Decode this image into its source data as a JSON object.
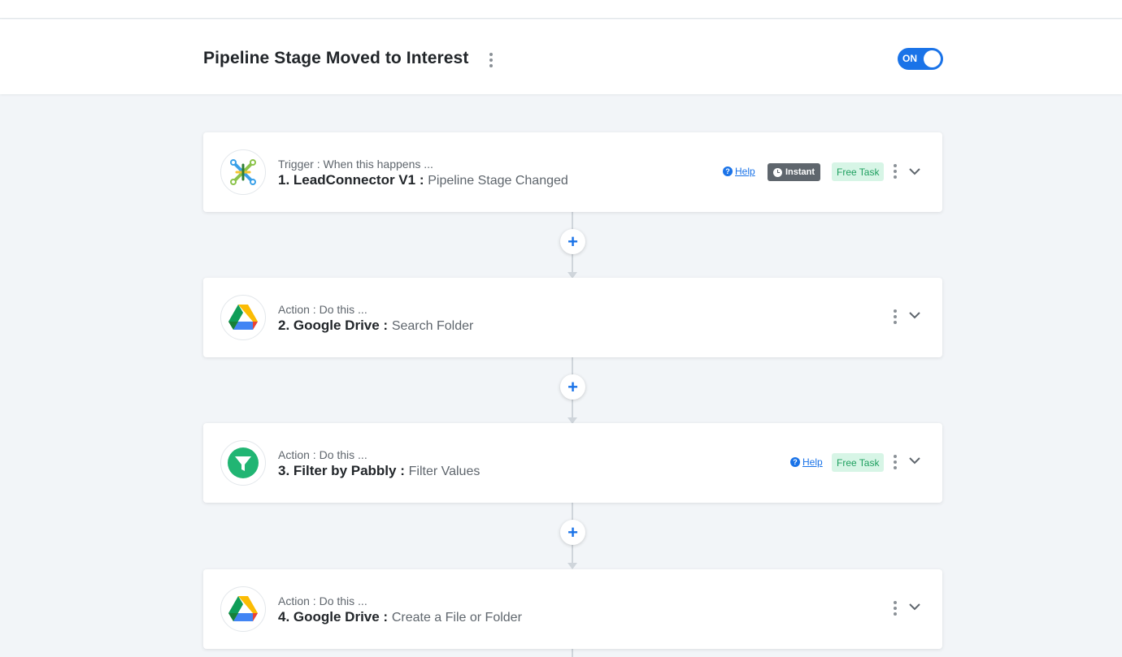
{
  "header": {
    "title": "Pipeline Stage Moved to Interest",
    "toggle_label": "ON"
  },
  "steps": [
    {
      "sub": "Trigger : When this happens ...",
      "app": "1. LeadConnector V1 :",
      "event": "Pipeline Stage Changed",
      "help": "Help",
      "instant": "Instant",
      "free_task": "Free Task",
      "icon": "leadconnector-icon"
    },
    {
      "sub": "Action : Do this ...",
      "app": "2. Google Drive :",
      "event": "Search Folder",
      "icon": "google-drive-icon"
    },
    {
      "sub": "Action : Do this ...",
      "app": "3. Filter by Pabbly :",
      "event": "Filter Values",
      "help": "Help",
      "free_task": "Free Task",
      "icon": "filter-icon"
    },
    {
      "sub": "Action : Do this ...",
      "app": "4. Google Drive :",
      "event": "Create a File or Folder",
      "icon": "google-drive-icon"
    }
  ],
  "add_step_symbol": "+",
  "colors": {
    "accent": "#1a73e8",
    "free_task_bg": "#d7f5e6",
    "free_task_text": "#1e9f5f",
    "instant_bg": "#5f666d",
    "filter_green": "#21b573"
  }
}
